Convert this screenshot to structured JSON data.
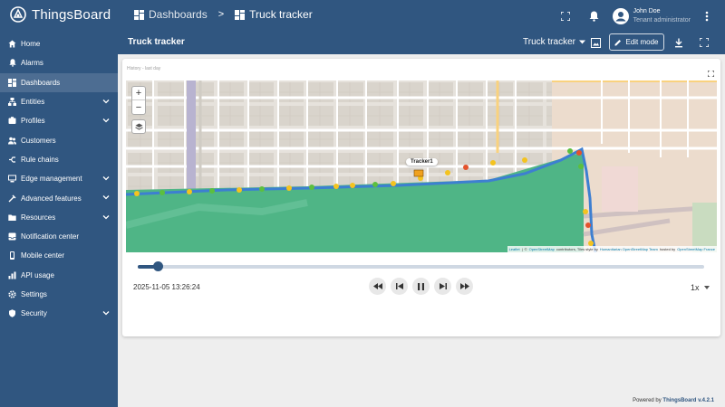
{
  "app": {
    "logo_text": "ThingsBoard"
  },
  "breadcrumb": {
    "dashboards": "Dashboards",
    "separator": ">",
    "current": "Truck tracker"
  },
  "user": {
    "name": "John Doe",
    "role": "Tenant administrator"
  },
  "sidebar": {
    "items": [
      {
        "label": "Home",
        "icon": "home-icon"
      },
      {
        "label": "Alarms",
        "icon": "bell-icon"
      },
      {
        "label": "Dashboards",
        "icon": "dashboard-icon",
        "active": true
      },
      {
        "label": "Entities",
        "icon": "entities-icon",
        "expandable": true
      },
      {
        "label": "Profiles",
        "icon": "profiles-icon",
        "expandable": true
      },
      {
        "label": "Customers",
        "icon": "customers-icon"
      },
      {
        "label": "Rule chains",
        "icon": "rule-chains-icon"
      },
      {
        "label": "Edge management",
        "icon": "edge-icon",
        "expandable": true
      },
      {
        "label": "Advanced features",
        "icon": "advanced-icon",
        "expandable": true
      },
      {
        "label": "Resources",
        "icon": "folder-icon",
        "expandable": true
      },
      {
        "label": "Notification center",
        "icon": "inbox-icon"
      },
      {
        "label": "Mobile center",
        "icon": "mobile-icon"
      },
      {
        "label": "API usage",
        "icon": "api-usage-icon"
      },
      {
        "label": "Settings",
        "icon": "settings-icon"
      },
      {
        "label": "Security",
        "icon": "security-icon",
        "expandable": true
      }
    ]
  },
  "dashboard": {
    "title": "Truck tracker",
    "state_selector": "Truck tracker",
    "edit_mode_label": "Edit mode"
  },
  "widget": {
    "title": "History - last day",
    "tracker_label": "Tracker1",
    "attribution": {
      "leaflet": "Leaflet",
      "sep1": "|",
      "copyright": "©",
      "osm": "OpenStreetMap",
      "contributors": "contributors, Tiles style by",
      "hot": "Humanitarian OpenStreetMap Team",
      "hosted": "hosted by",
      "osmfr": "OpenStreetMap France"
    },
    "street_labels": [
      "Balboa Street",
      "Cabrillo Street",
      "Cabrillo Street",
      "Fulton Street",
      "Fulton Street",
      "Golden Gate Avenue",
      "Grove Street",
      "Jamestown Elementary School",
      "Argonne Elementary School",
      "University of San Francisco",
      "Saint Mary's Medical Center",
      "New Traditions Elementary School",
      "Jamestown Child Development Center"
    ],
    "timestamp": "2025-11-05 13:26:24",
    "progress": 0.035,
    "speed": "1x"
  },
  "footer": {
    "prefix": "Powered by",
    "brand": "ThingsBoard v.4.2.1"
  },
  "colors": {
    "primary": "#305680",
    "park": "#52b889",
    "route": "#3d7fd1"
  }
}
